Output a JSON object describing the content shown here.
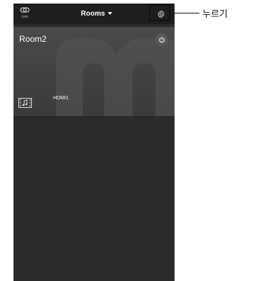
{
  "header": {
    "link_icon": "link-icon",
    "link_label": "Link",
    "title": "Rooms",
    "title_caret_icon": "caret-down-icon",
    "settings_icon": "gear-icon"
  },
  "room": {
    "name": "Room2",
    "power_icon": "power-icon",
    "source_icon": "music-video-source-icon",
    "source_label": "HDMI1"
  },
  "annotation": {
    "label": "누르기"
  },
  "colors": {
    "topbar": "#1e1e1e",
    "screen_bg": "#2b2b2b",
    "card_bg": "#454545",
    "text": "#ffffff"
  }
}
